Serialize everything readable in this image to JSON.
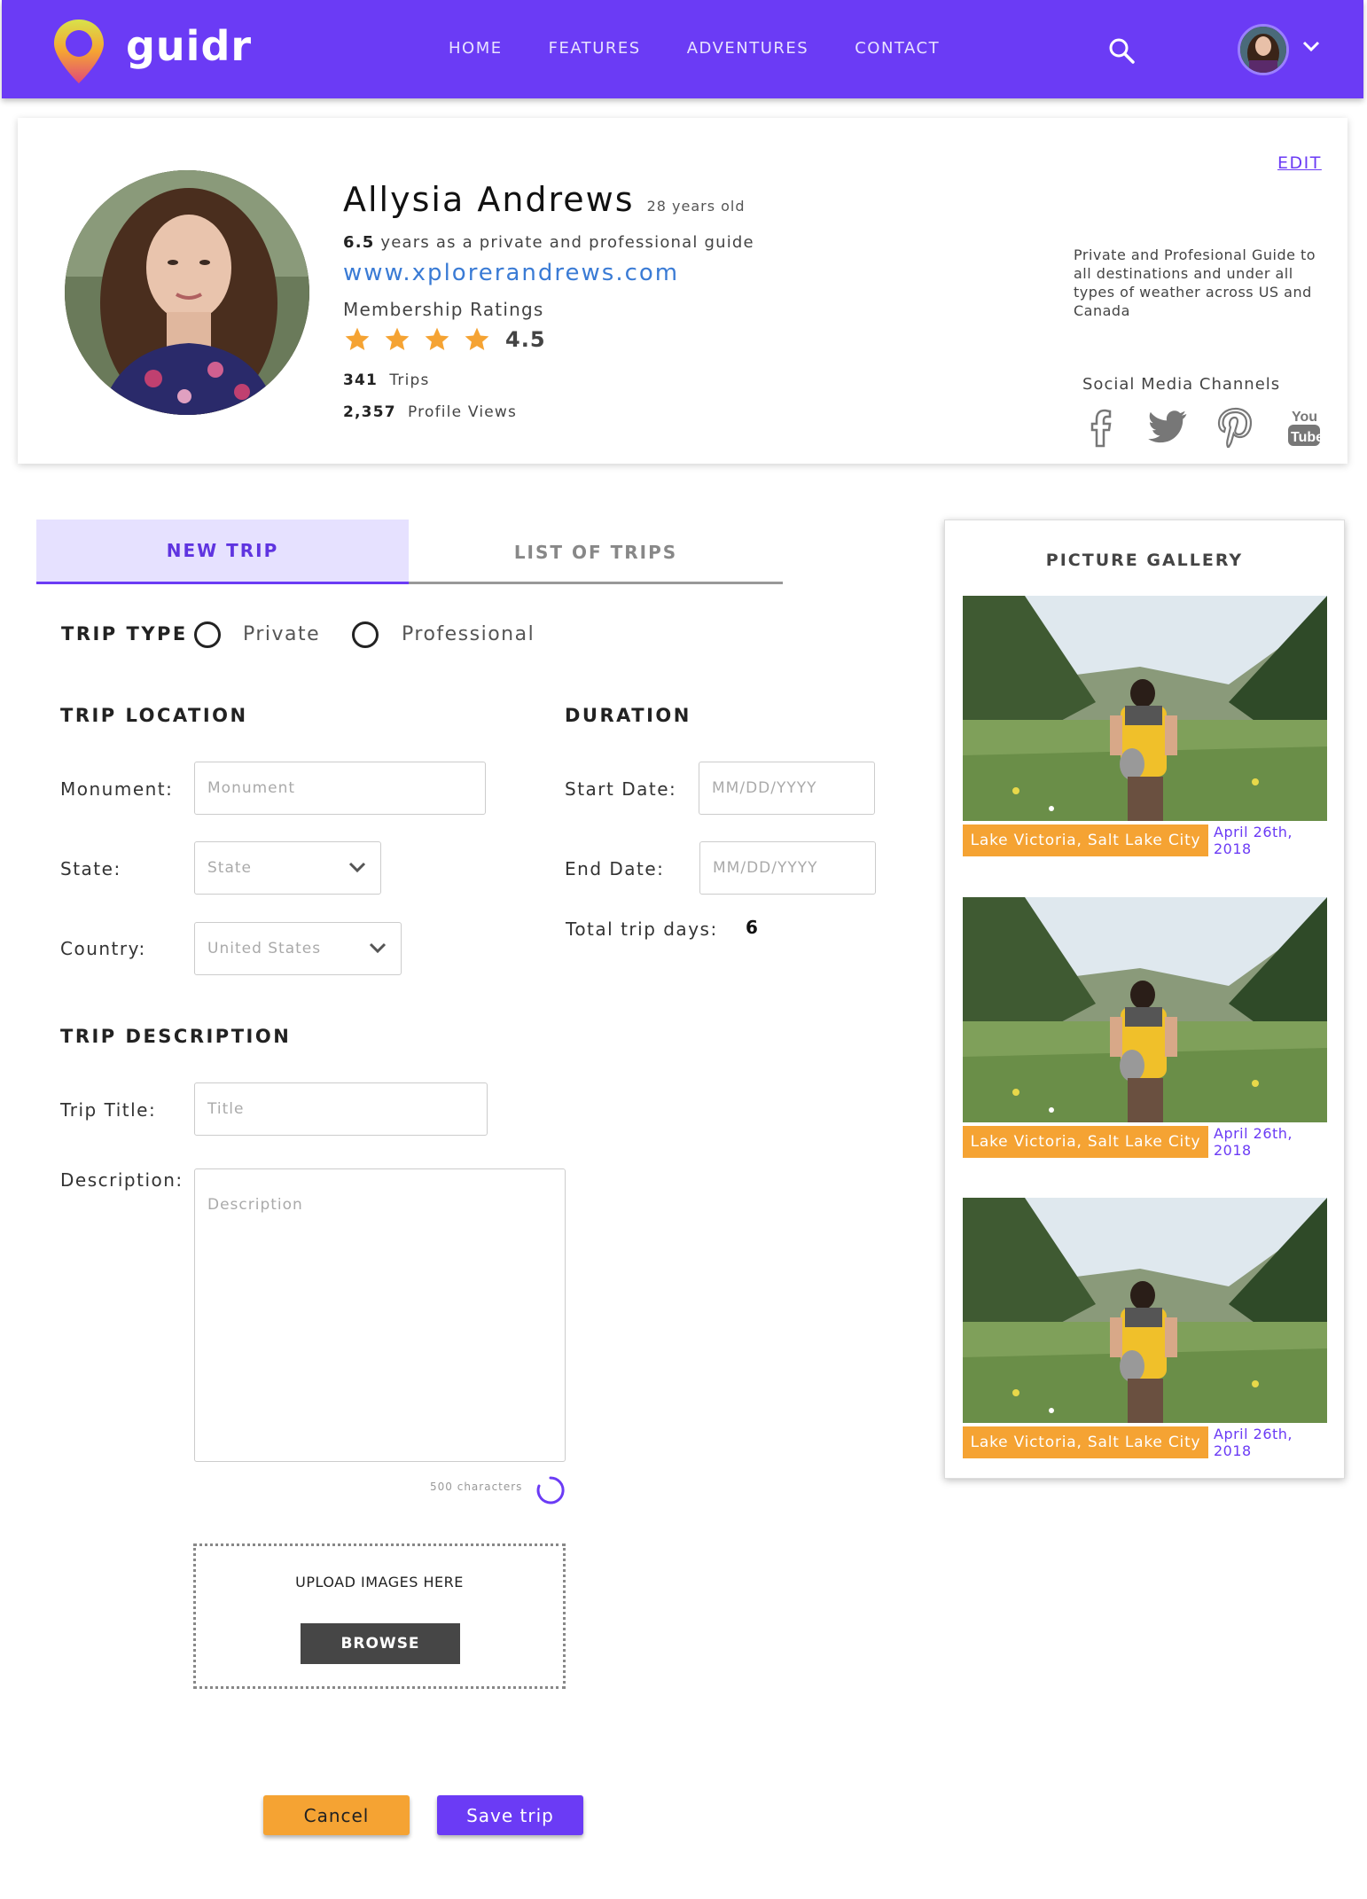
{
  "brand": {
    "name": "guidr"
  },
  "nav": {
    "links": [
      "HOME",
      "FEATURES",
      "ADVENTURES",
      "CONTACT"
    ],
    "icons": {
      "search": "search-icon",
      "avatar": "avatar",
      "dropdown": "chevron-down-icon"
    }
  },
  "profile": {
    "name": "Allysia Andrews",
    "age": "28 years old",
    "experience_years": "6.5",
    "experience_text": "years as a private and professional guide",
    "website": "www.xplorerandrews.com",
    "ratings_label": "Membership Ratings",
    "rating": "4.5",
    "stars_shown": 4,
    "trips_count": "341",
    "trips_label": "Trips",
    "views_count": "2,357",
    "views_label": "Profile Views",
    "edit_label": "EDIT",
    "bio": "Private and Profesional Guide to all destinations and under all types of weather across US and Canada",
    "social_label": "Social Media Channels",
    "social": [
      "facebook-icon",
      "twitter-icon",
      "pinterest-icon",
      "youtube-icon"
    ]
  },
  "tabs": {
    "new_trip": "NEW TRIP",
    "list_trips": "LIST OF TRIPS"
  },
  "form": {
    "trip_type_label": "TRIP TYPE",
    "trip_type_options": [
      "Private",
      "Professional"
    ],
    "location_section": "TRIP LOCATION",
    "duration_section": "DURATION",
    "monument_label": "Monument:",
    "monument_placeholder": "Monument",
    "state_label": "State:",
    "state_value": "State",
    "country_label": "Country:",
    "country_value": "United States",
    "start_label": "Start Date:",
    "start_placeholder": "MM/DD/YYYY",
    "end_label": "End Date:",
    "end_placeholder": "MM/DD/YYYY",
    "total_days_label": "Total trip days:",
    "total_days_value": "6",
    "description_section": "TRIP DESCRIPTION",
    "title_label": "Trip Title:",
    "title_placeholder": "Title",
    "description_label": "Description:",
    "description_placeholder": "Description",
    "char_counter": "500 characters",
    "upload_label": "UPLOAD IMAGES HERE",
    "browse_label": "BROWSE",
    "cancel_label": "Cancel",
    "save_label": "Save trip"
  },
  "gallery": {
    "title": "PICTURE GALLERY",
    "items": [
      {
        "caption": "Lake Victoria, Salt Lake City",
        "date": "April 26th, 2018"
      },
      {
        "caption": "Lake Victoria, Salt Lake City",
        "date": "April 26th, 2018"
      },
      {
        "caption": "Lake Victoria, Salt Lake City",
        "date": "April 26th, 2018"
      }
    ]
  },
  "colors": {
    "primary": "#6b3bf5",
    "accent": "#f5a333",
    "link": "#3a7bd5",
    "tab_bg": "#e6e1ff"
  }
}
